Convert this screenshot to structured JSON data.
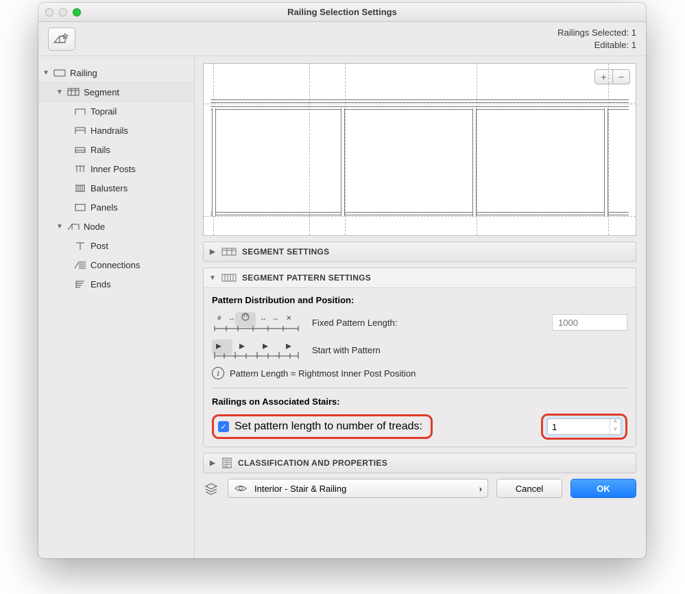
{
  "window": {
    "title": "Railing Selection Settings"
  },
  "status": {
    "selected": "Railings Selected: 1",
    "editable": "Editable: 1"
  },
  "tree": {
    "railing": "Railing",
    "segment": "Segment",
    "toprail": "Toprail",
    "handrails": "Handrails",
    "rails": "Rails",
    "inner_posts": "Inner Posts",
    "balusters": "Balusters",
    "panels": "Panels",
    "node": "Node",
    "post": "Post",
    "connections": "Connections",
    "ends": "Ends"
  },
  "acc": {
    "segment_settings": "SEGMENT SETTINGS",
    "pattern_settings": "SEGMENT PATTERN SETTINGS",
    "classification": "CLASSIFICATION AND PROPERTIES"
  },
  "pattern": {
    "section_label": "Pattern Distribution and Position:",
    "fixed_label": "Fixed Pattern Length:",
    "fixed_value_placeholder": "1000",
    "start_label": "Start with Pattern",
    "info": "Pattern Length = Rightmost Inner Post Position"
  },
  "assoc": {
    "section_label": "Railings on Associated Stairs:",
    "checkbox_label": "Set pattern length to number of treads:",
    "spinner_value": "1"
  },
  "footer": {
    "layer": "Interior - Stair & Railing",
    "cancel": "Cancel",
    "ok": "OK"
  },
  "icons": {
    "plus": "+",
    "minus": "−",
    "check": "✓",
    "chev_right": "›",
    "tri_right": "▶",
    "tri_down": "▼"
  }
}
